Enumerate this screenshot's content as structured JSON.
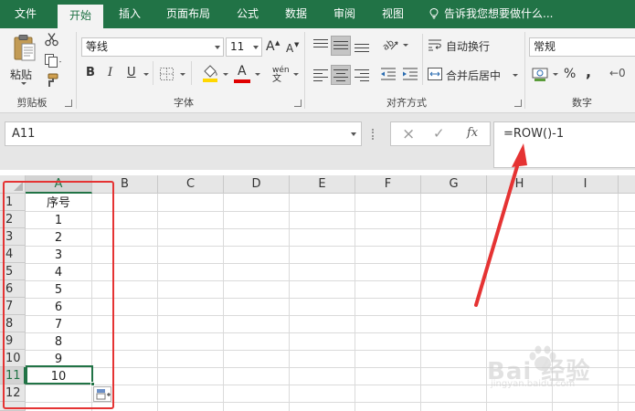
{
  "ribbon_tabs": [
    {
      "label": "文件",
      "active": false
    },
    {
      "label": "开始",
      "active": true
    },
    {
      "label": "插入",
      "active": false
    },
    {
      "label": "页面布局",
      "active": false
    },
    {
      "label": "公式",
      "active": false
    },
    {
      "label": "数据",
      "active": false
    },
    {
      "label": "审阅",
      "active": false
    },
    {
      "label": "视图",
      "active": false
    }
  ],
  "tell_me": "告诉我您想要做什么...",
  "clipboard": {
    "paste_label": "粘贴",
    "group_label": "剪贴板",
    "paste_icon": "paste-icon",
    "cut_icon": "scissors-icon",
    "copy_icon": "copy-icon",
    "format_painter_icon": "paintbrush-icon"
  },
  "font": {
    "group_label": "字体",
    "font_name": "等线",
    "font_size": "11",
    "bold": "B",
    "italic": "I",
    "underline": "U",
    "grow": "A",
    "shrink": "A",
    "phonetic": "wén",
    "fill_color": "#ffd700",
    "font_color": "#e00000"
  },
  "alignment": {
    "group_label": "对齐方式",
    "wrap_text": "自动换行",
    "merge_center": "合并后居中"
  },
  "number": {
    "group_label": "数字",
    "format": "常规",
    "percent": "%",
    "comma": ","
  },
  "formula_bar": {
    "name_box": "A11",
    "cancel_icon": "×",
    "enter_icon": "✓",
    "fx_label": "fx",
    "formula": "=ROW()-1"
  },
  "sheet": {
    "columns": [
      "A",
      "B",
      "C",
      "D",
      "E",
      "F",
      "G",
      "H",
      "I"
    ],
    "selected_column": "A",
    "rows": [
      "1",
      "2",
      "3",
      "4",
      "5",
      "6",
      "7",
      "8",
      "9",
      "10",
      "11",
      "12"
    ],
    "selected_row": "11",
    "column_a": [
      "序号",
      "1",
      "2",
      "3",
      "4",
      "5",
      "6",
      "7",
      "8",
      "9",
      "10",
      ""
    ],
    "active_cell": "A11"
  },
  "annotation": {
    "box_color": "#e53333",
    "arrow_color": "#e53333"
  },
  "watermark": {
    "text": "Bai 经验",
    "url": "jingyan.baidu.com"
  },
  "colors": {
    "excel_green": "#217346",
    "ribbon_bg": "#f3f3f3"
  }
}
